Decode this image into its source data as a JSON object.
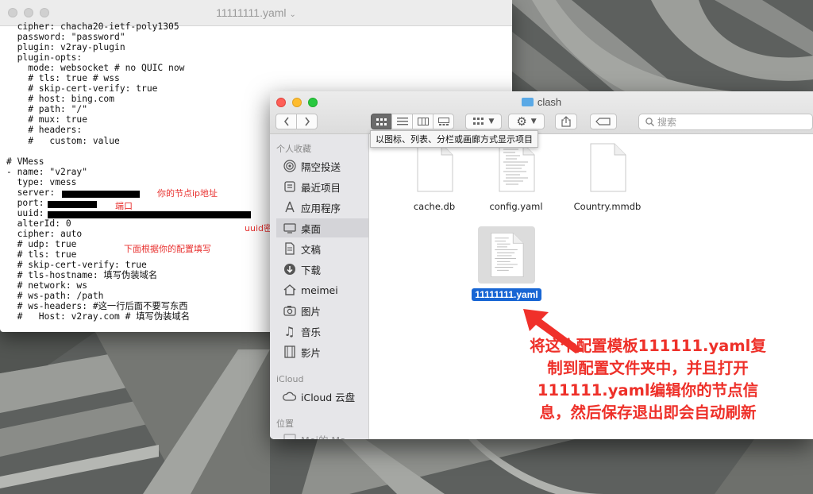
{
  "editor": {
    "title": "11111111.yaml",
    "code_lines": [
      "  cipher: chacha20-ietf-poly1305",
      "  password: \"password\"",
      "  plugin: v2ray-plugin",
      "  plugin-opts:",
      "    mode: websocket # no QUIC now",
      "    # tls: true # wss",
      "    # skip-cert-verify: true",
      "    # host: bing.com",
      "    # path: \"/\"",
      "    # mux: true",
      "    # headers:",
      "    #   custom: value",
      "",
      "# VMess",
      "- name: \"v2ray\"",
      "  type: vmess",
      "  server: ",
      "  port: ",
      "  uuid:",
      "  alterId: 0",
      "  cipher: auto",
      "  # udp: true",
      "  # tls: true",
      "  # skip-cert-verify: true",
      "  # tls-hostname: 填写伪装域名",
      "  # network: ws",
      "  # ws-path: /path",
      "  # ws-headers: #这一行后面不要写东西",
      "  #   Host: v2ray.com # 填写伪装域名"
    ],
    "annotations": {
      "server_note": "你的节点ip地址",
      "port_note": "端口",
      "uuid_note": "uuid密码",
      "config_note": "下面根据你的配置填写"
    }
  },
  "finder": {
    "title": "clash",
    "search_placeholder": "搜索",
    "tooltip": "以图标、列表、分栏或画廊方式显示项目",
    "sidebar": {
      "favorites_heading": "个人收藏",
      "favorites": [
        {
          "label": "隔空投送",
          "icon": "airdrop-icon"
        },
        {
          "label": "最近项目",
          "icon": "recents-icon"
        },
        {
          "label": "应用程序",
          "icon": "applications-icon"
        },
        {
          "label": "桌面",
          "icon": "desktop-icon"
        },
        {
          "label": "文稿",
          "icon": "documents-icon"
        },
        {
          "label": "下载",
          "icon": "downloads-icon"
        },
        {
          "label": "meimei",
          "icon": "home-icon"
        },
        {
          "label": "图片",
          "icon": "pictures-icon"
        },
        {
          "label": "音乐",
          "icon": "music-icon"
        },
        {
          "label": "影片",
          "icon": "movies-icon"
        }
      ],
      "icloud_heading": "iCloud",
      "icloud_items": [
        {
          "label": "iCloud 云盘",
          "icon": "icloud-icon"
        }
      ],
      "locations_heading": "位置",
      "locations": [
        {
          "label": "Mei的 Ma",
          "icon": "computer-icon"
        }
      ]
    },
    "files": [
      {
        "name": "cache.db",
        "selected": false
      },
      {
        "name": "config.yaml",
        "selected": false
      },
      {
        "name": "Country.mmdb",
        "selected": false
      },
      {
        "name": "11111111.yaml",
        "selected": true
      }
    ]
  },
  "instruction_lines": [
    "将这个配置模板111111.yaml复",
    "制到配置文件夹中，并且打开",
    "111111.yaml编辑你的节点信",
    "息，然后保存退出即会自动刷新"
  ],
  "colors": {
    "annotation": "#e8312f",
    "selection": "#1866d4",
    "arrow": "#f0302a"
  }
}
